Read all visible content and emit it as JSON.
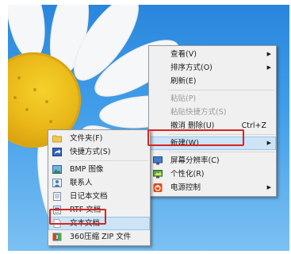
{
  "context_menu": {
    "items": [
      {
        "label": "查看(V)",
        "submenu": true
      },
      {
        "label": "排序方式(O)",
        "submenu": true
      },
      {
        "label": "刷新(E)"
      },
      {
        "label": "粘贴(P)",
        "disabled": true
      },
      {
        "label": "粘贴快捷方式(S)",
        "disabled": true
      },
      {
        "label": "撤消 删除(U)",
        "shortcut": "Ctrl+Z"
      },
      {
        "label": "新建(W)",
        "submenu": true,
        "highlighted": true
      },
      {
        "label": "屏幕分辨率(C)",
        "icon": "display-icon"
      },
      {
        "label": "个性化(R)",
        "icon": "personalize-icon"
      },
      {
        "label": "电源控制",
        "submenu": true,
        "icon": "power-icon"
      }
    ]
  },
  "new_submenu": {
    "items": [
      {
        "label": "文件夹(F)",
        "icon": "folder-icon"
      },
      {
        "label": "快捷方式(S)",
        "icon": "shortcut-icon"
      },
      {
        "label": "BMP 图像",
        "icon": "bmp-image-icon"
      },
      {
        "label": "联系人",
        "icon": "contact-icon"
      },
      {
        "label": "日记本文档",
        "icon": "journal-icon"
      },
      {
        "label": "RTF 文档",
        "icon": "rtf-document-icon"
      },
      {
        "label": "文本文档",
        "icon": "text-document-icon",
        "highlighted": true
      },
      {
        "label": "360压缩 ZIP 文件",
        "icon": "zip-archive-icon"
      }
    ]
  },
  "colors": {
    "menu_bg": "#f0f0f0",
    "highlight": "#cde4f7",
    "callout_red": "#d8241f",
    "sky": "#2a86dd"
  }
}
